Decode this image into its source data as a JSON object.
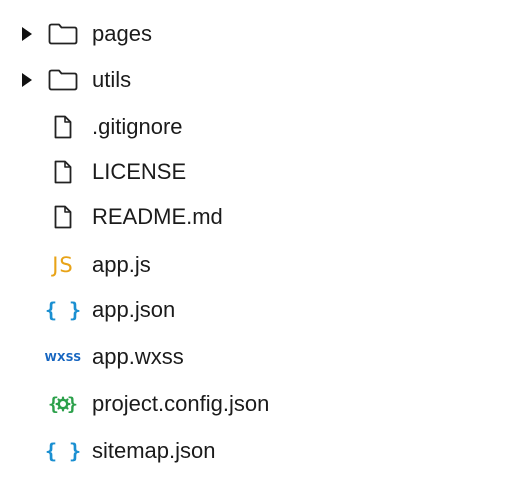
{
  "tree": {
    "items": [
      {
        "label": "pages",
        "kind": "folder",
        "expanded": false,
        "icon": "folder-icon"
      },
      {
        "label": "utils",
        "kind": "folder",
        "expanded": false,
        "icon": "folder-icon"
      },
      {
        "label": ".gitignore",
        "kind": "file",
        "icon": "file-icon"
      },
      {
        "label": "LICENSE",
        "kind": "file",
        "icon": "file-icon"
      },
      {
        "label": "README.md",
        "kind": "file",
        "icon": "file-icon"
      },
      {
        "label": "app.js",
        "kind": "file",
        "icon": "js-icon",
        "icon_text": "JS"
      },
      {
        "label": "app.json",
        "kind": "file",
        "icon": "json-icon",
        "icon_text": "{ }"
      },
      {
        "label": "app.wxss",
        "kind": "file",
        "icon": "wxss-icon",
        "icon_text": "WXSS"
      },
      {
        "label": "project.config.json",
        "kind": "file",
        "icon": "config-json-icon",
        "icon_text": "{⚙}"
      },
      {
        "label": "sitemap.json",
        "kind": "file",
        "icon": "json-icon",
        "icon_text": "{ }"
      }
    ]
  },
  "colors": {
    "js": "#e8a317",
    "json": "#1a8fd1",
    "wxss": "#1565c0",
    "config": "#2ba04a",
    "text": "#1b1b1b"
  }
}
